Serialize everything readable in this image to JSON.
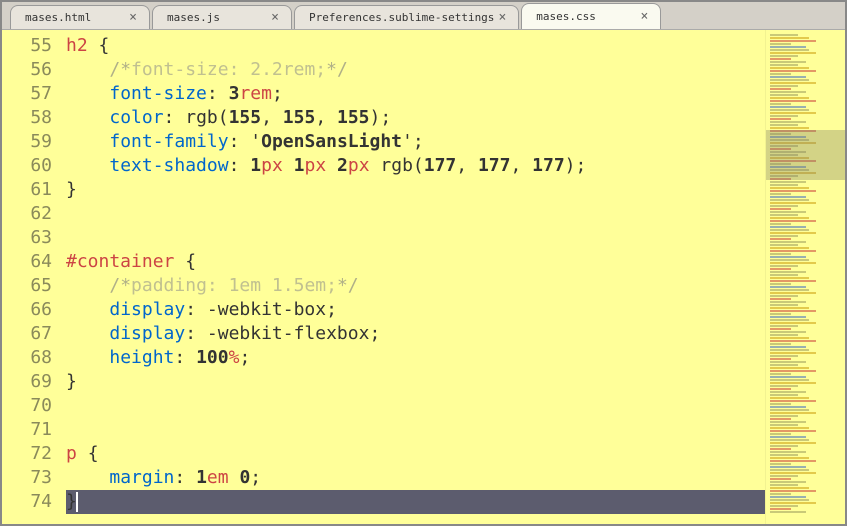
{
  "tabs": [
    {
      "label": "mases.html",
      "active": false
    },
    {
      "label": "mases.js",
      "active": false
    },
    {
      "label": "Preferences.sublime-settings",
      "active": false
    },
    {
      "label": "mases.css",
      "active": true
    }
  ],
  "gutter": {
    "start": 55,
    "end": 74
  },
  "code": {
    "lines": [
      {
        "no": 55,
        "tokens": [
          {
            "t": "h2",
            "c": "sel"
          },
          {
            "t": " "
          },
          {
            "t": "{",
            "c": "brace"
          }
        ]
      },
      {
        "no": 56,
        "tokens": [
          {
            "t": "    "
          },
          {
            "t": "/*",
            "c": "comment"
          },
          {
            "t": "font-size: 2.2rem;",
            "c": "comment-inner"
          },
          {
            "t": "*/",
            "c": "comment"
          }
        ]
      },
      {
        "no": 57,
        "tokens": [
          {
            "t": "    "
          },
          {
            "t": "font-size",
            "c": "prop"
          },
          {
            "t": ": "
          },
          {
            "t": "3",
            "c": "num"
          },
          {
            "t": "rem",
            "c": "unit"
          },
          {
            "t": ";"
          }
        ]
      },
      {
        "no": 58,
        "tokens": [
          {
            "t": "    "
          },
          {
            "t": "color",
            "c": "prop"
          },
          {
            "t": ": "
          },
          {
            "t": "rgb",
            "c": "func"
          },
          {
            "t": "("
          },
          {
            "t": "155",
            "c": "num"
          },
          {
            "t": ", "
          },
          {
            "t": "155",
            "c": "num"
          },
          {
            "t": ", "
          },
          {
            "t": "155",
            "c": "num"
          },
          {
            "t": ");"
          }
        ]
      },
      {
        "no": 59,
        "tokens": [
          {
            "t": "    "
          },
          {
            "t": "font-family",
            "c": "prop"
          },
          {
            "t": ": "
          },
          {
            "t": "'",
            "c": "str"
          },
          {
            "t": "OpenSansLight",
            "c": "str-inner"
          },
          {
            "t": "'",
            "c": "str"
          },
          {
            "t": ";"
          }
        ]
      },
      {
        "no": 60,
        "tokens": [
          {
            "t": "    "
          },
          {
            "t": "text-shadow",
            "c": "prop"
          },
          {
            "t": ": "
          },
          {
            "t": "1",
            "c": "num"
          },
          {
            "t": "px",
            "c": "unit"
          },
          {
            "t": " "
          },
          {
            "t": "1",
            "c": "num"
          },
          {
            "t": "px",
            "c": "unit"
          },
          {
            "t": " "
          },
          {
            "t": "2",
            "c": "num"
          },
          {
            "t": "px",
            "c": "unit"
          },
          {
            "t": " "
          },
          {
            "t": "rgb",
            "c": "func"
          },
          {
            "t": "("
          },
          {
            "t": "177",
            "c": "num"
          },
          {
            "t": ", "
          },
          {
            "t": "177",
            "c": "num"
          },
          {
            "t": ", "
          },
          {
            "t": "177",
            "c": "num"
          },
          {
            "t": ");"
          }
        ]
      },
      {
        "no": 61,
        "tokens": [
          {
            "t": "}",
            "c": "brace"
          }
        ]
      },
      {
        "no": 62,
        "tokens": []
      },
      {
        "no": 63,
        "tokens": []
      },
      {
        "no": 64,
        "tokens": [
          {
            "t": "#container",
            "c": "sel"
          },
          {
            "t": " "
          },
          {
            "t": "{",
            "c": "brace"
          }
        ]
      },
      {
        "no": 65,
        "tokens": [
          {
            "t": "    "
          },
          {
            "t": "/*",
            "c": "comment"
          },
          {
            "t": "padding: 1em 1.5em;",
            "c": "comment-inner"
          },
          {
            "t": "*/",
            "c": "comment"
          }
        ]
      },
      {
        "no": 66,
        "tokens": [
          {
            "t": "    "
          },
          {
            "t": "display",
            "c": "prop"
          },
          {
            "t": ": -webkit-box;"
          }
        ]
      },
      {
        "no": 67,
        "tokens": [
          {
            "t": "    "
          },
          {
            "t": "display",
            "c": "prop"
          },
          {
            "t": ": -webkit-flexbox;"
          }
        ]
      },
      {
        "no": 68,
        "tokens": [
          {
            "t": "    "
          },
          {
            "t": "height",
            "c": "prop"
          },
          {
            "t": ": "
          },
          {
            "t": "100",
            "c": "num"
          },
          {
            "t": "%",
            "c": "unit"
          },
          {
            "t": ";"
          }
        ]
      },
      {
        "no": 69,
        "tokens": [
          {
            "t": "}",
            "c": "brace"
          }
        ]
      },
      {
        "no": 70,
        "tokens": []
      },
      {
        "no": 71,
        "tokens": []
      },
      {
        "no": 72,
        "tokens": [
          {
            "t": "p",
            "c": "sel"
          },
          {
            "t": " "
          },
          {
            "t": "{",
            "c": "brace"
          }
        ]
      },
      {
        "no": 73,
        "tokens": [
          {
            "t": "    "
          },
          {
            "t": "margin",
            "c": "prop"
          },
          {
            "t": ": "
          },
          {
            "t": "1",
            "c": "num"
          },
          {
            "t": "em",
            "c": "unit"
          },
          {
            "t": " "
          },
          {
            "t": "0",
            "c": "num"
          },
          {
            "t": ";"
          }
        ]
      },
      {
        "no": 74,
        "active": true,
        "tokens": [
          {
            "t": "}",
            "c": "brace"
          },
          {
            "t": "",
            "cursor": true
          }
        ]
      }
    ]
  }
}
